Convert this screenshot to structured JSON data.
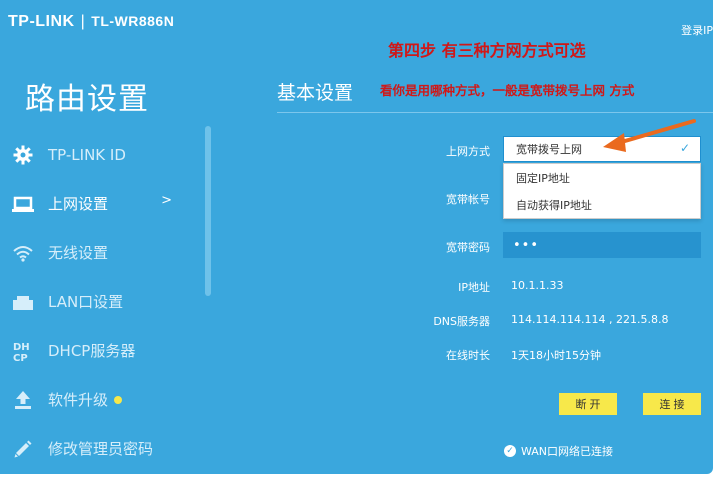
{
  "header": {
    "brand": "TP-LINK",
    "separator": "|",
    "model": "TL-WR886N",
    "login_link": "登录IP"
  },
  "annotations": {
    "step": "第四步  有三种方网方式可选",
    "hint": "看你是用哪种方式，一般是宽带拨号上网      方式",
    "arrow_color": "#ea6a1e"
  },
  "sidebar": {
    "title": "路由设置",
    "items": [
      {
        "label": "TP-LINK ID",
        "icon": "gear-icon"
      },
      {
        "label": "上网设置",
        "icon": "laptop-icon",
        "arrow": ">"
      },
      {
        "label": "无线设置",
        "icon": "wifi-icon"
      },
      {
        "label": "LAN口设置",
        "icon": "lan-port-icon"
      },
      {
        "label": "DHCP服务器",
        "icon": "dhcp-icon"
      },
      {
        "label": "软件升级",
        "icon": "upload-icon"
      },
      {
        "label": "修改管理员密码",
        "icon": "pencil-icon"
      }
    ]
  },
  "main": {
    "section_title": "基本设置",
    "fields": {
      "connection_type_label": "上网方式",
      "connection_type_selected": "宽带拨号上网",
      "connection_type_options": [
        "固定IP地址",
        "自动获得IP地址"
      ],
      "pppoe_account_label": "宽带帐号",
      "pppoe_password_label": "宽带密码",
      "pppoe_password_value": "•••",
      "ip_label": "IP地址",
      "ip_value": "10.1.1.33",
      "dns_label": "DNS服务器",
      "dns_value": "114.114.114.114 , 221.5.8.8",
      "online_time_label": "在线时长",
      "online_time_value": "1天18小时15分钟"
    },
    "buttons": {
      "disconnect": "断 开",
      "connect": "连 接"
    },
    "wan_status": "WAN口网络已连接"
  },
  "colors": {
    "background": "#3aa7dd",
    "accent_yellow": "#f7e84a",
    "annotation_red": "#d01818",
    "input_dark": "#2793cf"
  }
}
